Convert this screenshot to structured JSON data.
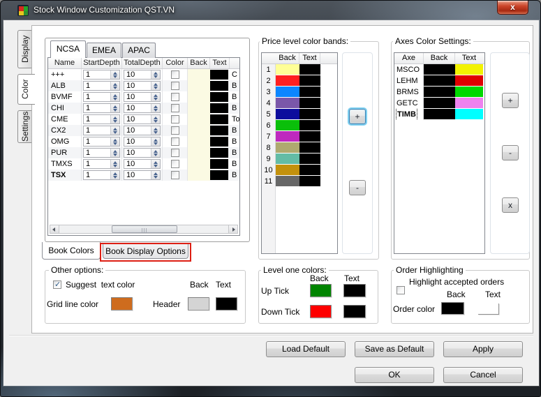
{
  "window": {
    "title": "Stock Window Customization QST.VN",
    "close_glyph": "x"
  },
  "side_tabs": {
    "active": "Color",
    "items": [
      {
        "label": "Display"
      },
      {
        "label": "Color"
      },
      {
        "label": "Settings"
      }
    ]
  },
  "book": {
    "region_tabs": {
      "active": "NCSA",
      "items": [
        {
          "label": "NCSA"
        },
        {
          "label": "EMEA"
        },
        {
          "label": "APAC"
        }
      ]
    },
    "table": {
      "columns": [
        "Name",
        "StartDepth",
        "TotalDepth",
        "Color",
        "Back",
        "Text"
      ],
      "rows": [
        {
          "name": "+++",
          "start_depth": "1",
          "total_depth": "10",
          "color_checked": false,
          "back": "#fbfae3",
          "text": "#000000",
          "clipped": "C",
          "bold": false
        },
        {
          "name": "ALB",
          "start_depth": "1",
          "total_depth": "10",
          "color_checked": false,
          "back": "#fbfae3",
          "text": "#000000",
          "clipped": "B",
          "bold": false
        },
        {
          "name": "BVMF",
          "start_depth": "1",
          "total_depth": "10",
          "color_checked": false,
          "back": "#fbfae3",
          "text": "#000000",
          "clipped": "B",
          "bold": false
        },
        {
          "name": "CHI",
          "start_depth": "1",
          "total_depth": "10",
          "color_checked": false,
          "back": "#fbfae3",
          "text": "#000000",
          "clipped": "B",
          "bold": false
        },
        {
          "name": "CME",
          "start_depth": "1",
          "total_depth": "10",
          "color_checked": false,
          "back": "#fbfae3",
          "text": "#000000",
          "clipped": "To",
          "bold": false
        },
        {
          "name": "CX2",
          "start_depth": "1",
          "total_depth": "10",
          "color_checked": false,
          "back": "#fbfae3",
          "text": "#000000",
          "clipped": "B",
          "bold": false
        },
        {
          "name": "OMG",
          "start_depth": "1",
          "total_depth": "10",
          "color_checked": false,
          "back": "#fbfae3",
          "text": "#000000",
          "clipped": "B",
          "bold": false
        },
        {
          "name": "PUR",
          "start_depth": "1",
          "total_depth": "10",
          "color_checked": false,
          "back": "#fbfae3",
          "text": "#000000",
          "clipped": "B",
          "bold": false
        },
        {
          "name": "TMXS",
          "start_depth": "1",
          "total_depth": "10",
          "color_checked": false,
          "back": "#fbfae3",
          "text": "#000000",
          "clipped": "B",
          "bold": false
        },
        {
          "name": "TSX",
          "start_depth": "1",
          "total_depth": "10",
          "color_checked": false,
          "back": "#fbfae3",
          "text": "#000000",
          "clipped": "B",
          "bold": true
        }
      ]
    },
    "bottom_tabs": {
      "active": "Book Colors",
      "items": [
        {
          "label": "Book Colors"
        },
        {
          "label": "Book Display Options",
          "annotated": true
        }
      ]
    }
  },
  "price_bands": {
    "title": "Price level color bands:",
    "columns": [
      "Back",
      "Text"
    ],
    "rows": [
      {
        "level": "1",
        "back": "#ffff96",
        "text": "#000000"
      },
      {
        "level": "2",
        "back": "#ff2020",
        "text": "#000000"
      },
      {
        "level": "3",
        "back": "#0c86ff",
        "text": "#000000"
      },
      {
        "level": "4",
        "back": "#7a57a9",
        "text": "#000000"
      },
      {
        "level": "5",
        "back": "#0d0d9d",
        "text": "#000000"
      },
      {
        "level": "6",
        "back": "#0abf0a",
        "text": "#000000"
      },
      {
        "level": "7",
        "back": "#be29be",
        "text": "#000000"
      },
      {
        "level": "8",
        "back": "#afa96f",
        "text": "#000000"
      },
      {
        "level": "9",
        "back": "#63bca6",
        "text": "#000000"
      },
      {
        "level": "10",
        "back": "#c3910d",
        "text": "#000000"
      },
      {
        "level": "11",
        "back": "#676767",
        "text": "#000000"
      }
    ],
    "add_label": "+",
    "remove_label": "-"
  },
  "axes": {
    "title": "Axes Color Settings:",
    "columns": [
      "Axe",
      "Back",
      "Text"
    ],
    "rows": [
      {
        "axe": "MSCO",
        "back": "#000000",
        "text": "#f2f200",
        "focused": false
      },
      {
        "axe": "LEHM",
        "back": "#000000",
        "text": "#e00000",
        "focused": false
      },
      {
        "axe": "BRMS",
        "back": "#000000",
        "text": "#00d800",
        "focused": false
      },
      {
        "axe": "GETC",
        "back": "#000000",
        "text": "#ee82ee",
        "focused": false
      },
      {
        "axe": "TIMB",
        "back": "#000000",
        "text": "#00ffff",
        "focused": true
      }
    ],
    "add_label": "+",
    "remove_label": "-",
    "delete_label": "x"
  },
  "other_options": {
    "title": "Other options:",
    "suggest_label": "Suggest  text color",
    "suggest_checked": true,
    "back_label": "Back",
    "text_label": "Text",
    "grid_line_label": "Grid line color",
    "grid_line_color": "#ce6c1e",
    "header_label": "Header",
    "header_back": "#d4d4d4",
    "header_text": "#000000"
  },
  "level_one": {
    "title": "Level one colors:",
    "back_label": "Back",
    "text_label": "Text",
    "rows": [
      {
        "label": "Up Tick",
        "back": "#018401",
        "text": "#000000"
      },
      {
        "label": "Down Tick",
        "back": "#fe0000",
        "text": "#000000"
      }
    ]
  },
  "order_highlighting": {
    "title": "Order Highlighting",
    "checkbox_label": "Highlight accepted orders",
    "checked": false,
    "back_label": "Back",
    "text_label": "Text",
    "order_color_label": "Order color",
    "back": "#000000",
    "text": "#ffffff"
  },
  "footer": {
    "buttons": [
      "Load Default",
      "Save as Default",
      "Apply",
      "OK",
      "Cancel"
    ]
  }
}
